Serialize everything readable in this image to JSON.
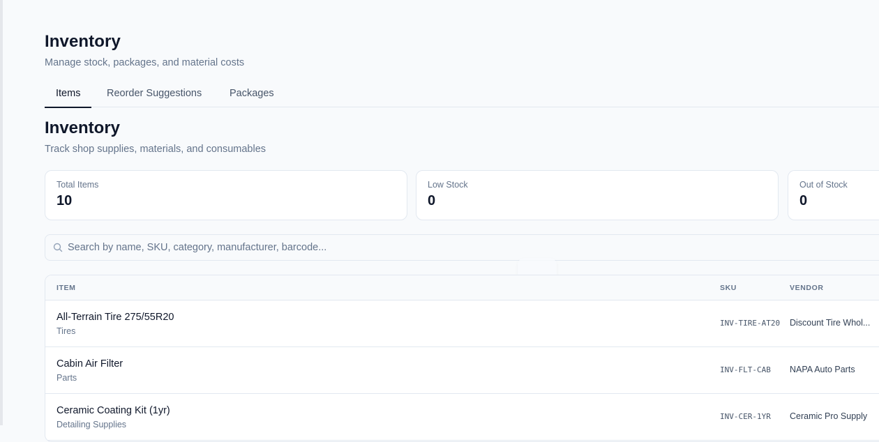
{
  "header": {
    "title": "Inventory",
    "subtitle": "Manage stock, packages, and material costs"
  },
  "tabs": [
    {
      "label": "Items",
      "active": true
    },
    {
      "label": "Reorder Suggestions",
      "active": false
    },
    {
      "label": "Packages",
      "active": false
    }
  ],
  "section": {
    "title": "Inventory",
    "subtitle": "Track shop supplies, materials, and consumables"
  },
  "stats": [
    {
      "label": "Total Items",
      "value": "10"
    },
    {
      "label": "Low Stock",
      "value": "0"
    },
    {
      "label": "Out of Stock",
      "value": "0"
    }
  ],
  "search": {
    "placeholder": "Search by name, SKU, category, manufacturer, barcode...",
    "value": "",
    "icon": "search-icon"
  },
  "table": {
    "columns": [
      "ITEM",
      "SKU",
      "VENDOR"
    ],
    "rows": [
      {
        "name": "All-Terrain Tire 275/55R20",
        "category": "Tires",
        "sku": "INV-TIRE-AT20",
        "vendor": "Discount Tire Whol..."
      },
      {
        "name": "Cabin Air Filter",
        "category": "Parts",
        "sku": "INV-FLT-CAB",
        "vendor": "NAPA Auto Parts"
      },
      {
        "name": "Ceramic Coating Kit (1yr)",
        "category": "Detailing Supplies",
        "sku": "INV-CER-1YR",
        "vendor": "Ceramic Pro Supply"
      }
    ]
  },
  "colors": {
    "background": "#f8fafc",
    "card": "#ffffff",
    "border": "#e2e8f0",
    "text_primary": "#0f172a",
    "text_muted": "#64748b"
  }
}
